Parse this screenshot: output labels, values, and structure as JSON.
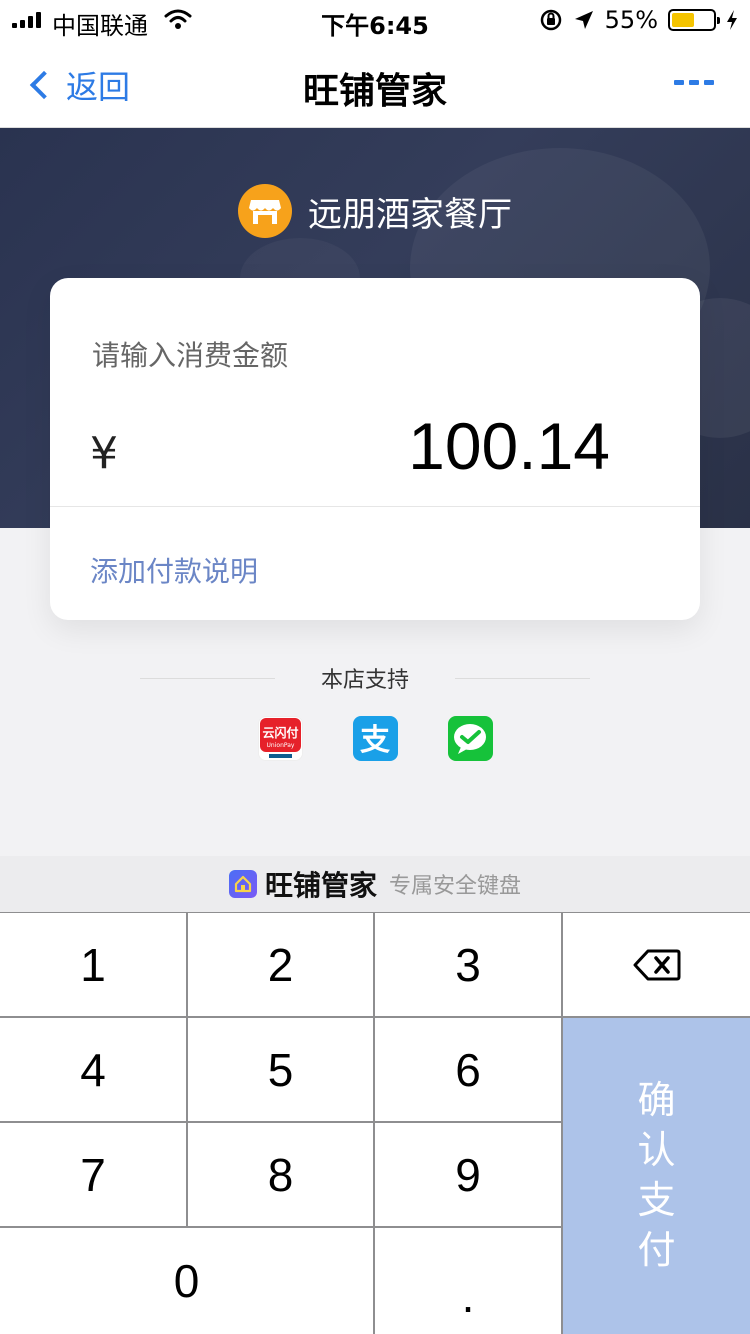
{
  "status_bar": {
    "carrier": "中国联通",
    "time": "下午6:45",
    "battery_percent": "55%",
    "battery_level": 0.55,
    "icons": [
      "signal-icon",
      "wifi-icon",
      "orientation-lock-icon",
      "location-arrow-icon",
      "battery-icon",
      "charging-icon"
    ]
  },
  "nav": {
    "back_label": "返回",
    "title": "旺铺管家",
    "more_icon": "more-dots-icon"
  },
  "shop": {
    "name": "远朋酒家餐厅",
    "icon": "storefront-icon",
    "icon_color": "#f7a21b"
  },
  "payment": {
    "prompt": "请输入消费金额",
    "currency_symbol": "¥",
    "amount": "100.14",
    "add_note": "添加付款说明"
  },
  "support": {
    "label": "本店支持",
    "methods": [
      {
        "name": "unionpay",
        "icon": "unionpay-icon",
        "text": "云闪付",
        "subtext": "UnionPay"
      },
      {
        "name": "alipay",
        "icon": "alipay-icon",
        "text": "支",
        "color": "#1aa0e8"
      },
      {
        "name": "wechat",
        "icon": "wechat-pay-icon",
        "color": "#16c23a"
      }
    ]
  },
  "keyboard": {
    "brand": "旺铺管家",
    "subtitle": "专属安全键盘",
    "keys": {
      "k1": "1",
      "k2": "2",
      "k3": "3",
      "k4": "4",
      "k5": "5",
      "k6": "6",
      "k7": "7",
      "k8": "8",
      "k9": "9",
      "k0": "0",
      "dot": "."
    },
    "delete_icon": "backspace-icon",
    "confirm": [
      "确",
      "认",
      "支",
      "付"
    ],
    "confirm_color": "#adc3e9"
  },
  "colors": {
    "accent": "#2d7be5",
    "hero_bg": "#2f3854",
    "link": "#6b86c6"
  }
}
